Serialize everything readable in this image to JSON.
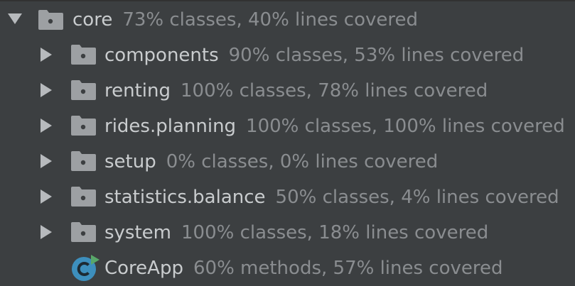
{
  "tree": {
    "root": {
      "name": "core",
      "stats": "73% classes, 40% lines covered",
      "expanded": true,
      "icon": "folder-package-icon",
      "children": [
        {
          "name": "components",
          "stats": "90% classes, 53% lines covered",
          "icon": "folder-package-icon"
        },
        {
          "name": "renting",
          "stats": "100% classes, 78% lines covered",
          "icon": "folder-package-icon"
        },
        {
          "name": "rides.planning",
          "stats": "100% classes, 100% lines covered",
          "icon": "folder-package-icon"
        },
        {
          "name": "setup",
          "stats": "0% classes, 0% lines covered",
          "icon": "folder-package-icon"
        },
        {
          "name": "statistics.balance",
          "stats": "50% classes, 4% lines covered",
          "icon": "folder-package-icon"
        },
        {
          "name": "system",
          "stats": "100% classes, 18% lines covered",
          "icon": "folder-package-icon"
        },
        {
          "name": "CoreApp",
          "stats": "60% methods, 57% lines covered",
          "icon": "runnable-class-icon"
        }
      ]
    }
  },
  "colors": {
    "background": "#3c3f41",
    "text": "#c9ccce",
    "stats_text": "#8a8d90",
    "folder": "#9da0a3",
    "class_icon": "#3d8fbd",
    "run_badge": "#59a869"
  }
}
